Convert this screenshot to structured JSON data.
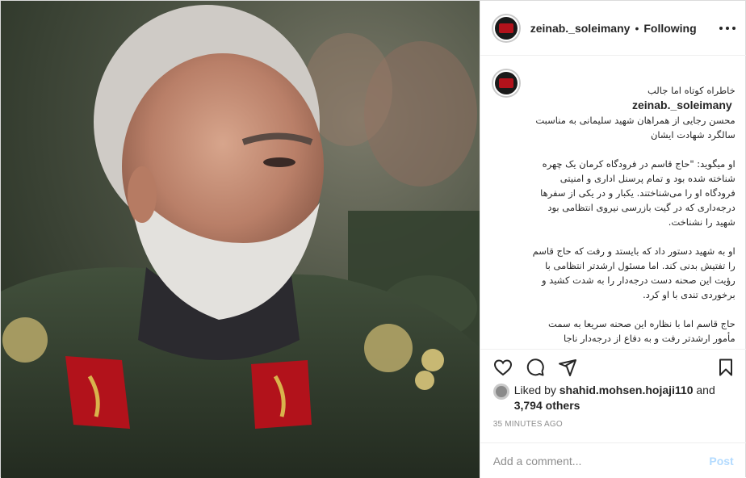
{
  "header": {
    "username": "zeinab._soleimany",
    "separator": "•",
    "follow_status": "Following",
    "more_icon": "more-options-icon"
  },
  "caption": {
    "username": "zeinab._soleimany",
    "first_line": "خاطراه کوتاه اما جالب",
    "text": "محسن رجایی از همراهان شهید سلیمانی به مناسبت سالگرد شهادت ایشان\n\nاو میگوید: \"حاج قاسم در فرودگاه کرمان یک چهره شناخته شده بود و تمام پرسنل اداری و امنیتی فرودگاه او را می‌شناختند. یکبار و در یکی از سفرها درجه‌داری که در گیت بازرسی نیروی انتظامی بود شهید را نشناخت.\n\nاو به شهید دستور داد که بایستد و رفت که حاج قاسم را تفتیش بدنی کند. اما مسئول ارشدتر انتظامی با رؤیت این صحنه دست درجه‌دار را به شدت کشید و برخوردی تندی با او کرد.\n\nحاج قاسم اما با نظاره این صحنه سریعا به سمت مأمور ارشدتر رفت و به دفاع از درجه‌دار ناجا پرداخت."
  },
  "actions": {
    "like_icon": "heart-icon",
    "comment_icon": "comment-icon",
    "share_icon": "share-icon",
    "save_icon": "bookmark-icon"
  },
  "likes": {
    "liked_by_user": "shahid.mohsen.hojaji110",
    "and_text": " and ",
    "others_count": "3,794 others"
  },
  "timestamp": "35 MINUTES AGO",
  "comment_box": {
    "placeholder": "Add a comment...",
    "post_label": "Post"
  },
  "colors": {
    "uniform": "#3b4a36",
    "badge_red": "#b2121b",
    "post_disabled": "#b3dbff"
  }
}
